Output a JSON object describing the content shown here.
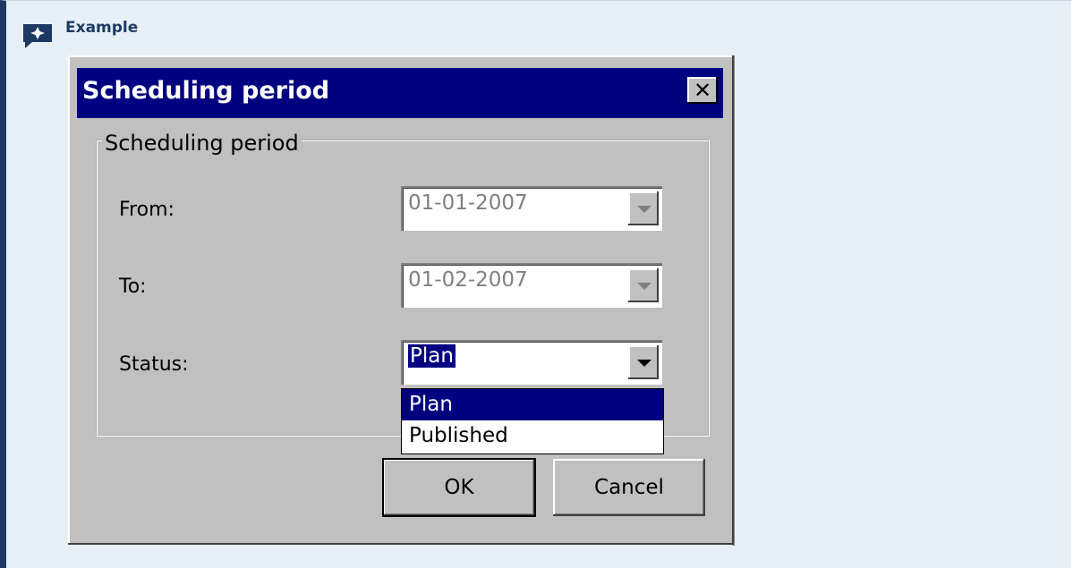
{
  "callout": {
    "icon": "sparkle-icon",
    "title": "Example",
    "accent_color": "#1e3a64",
    "background_color": "#e8f0f7"
  },
  "dialog": {
    "title": "Scheduling period",
    "close_label": "✕",
    "group_label": "Scheduling period",
    "fields": {
      "from": {
        "label": "From:",
        "value": "01-01-2007",
        "enabled": false
      },
      "to": {
        "label": "To:",
        "value": "01-02-2007",
        "enabled": false
      },
      "status": {
        "label": "Status:",
        "value": "Plan",
        "enabled": true
      }
    },
    "status_options": [
      "Plan",
      "Published"
    ],
    "status_selected_index": 0,
    "buttons": {
      "ok": "OK",
      "cancel": "Cancel"
    },
    "titlebar_color": "#000080",
    "face_color": "#c0c0c0"
  }
}
